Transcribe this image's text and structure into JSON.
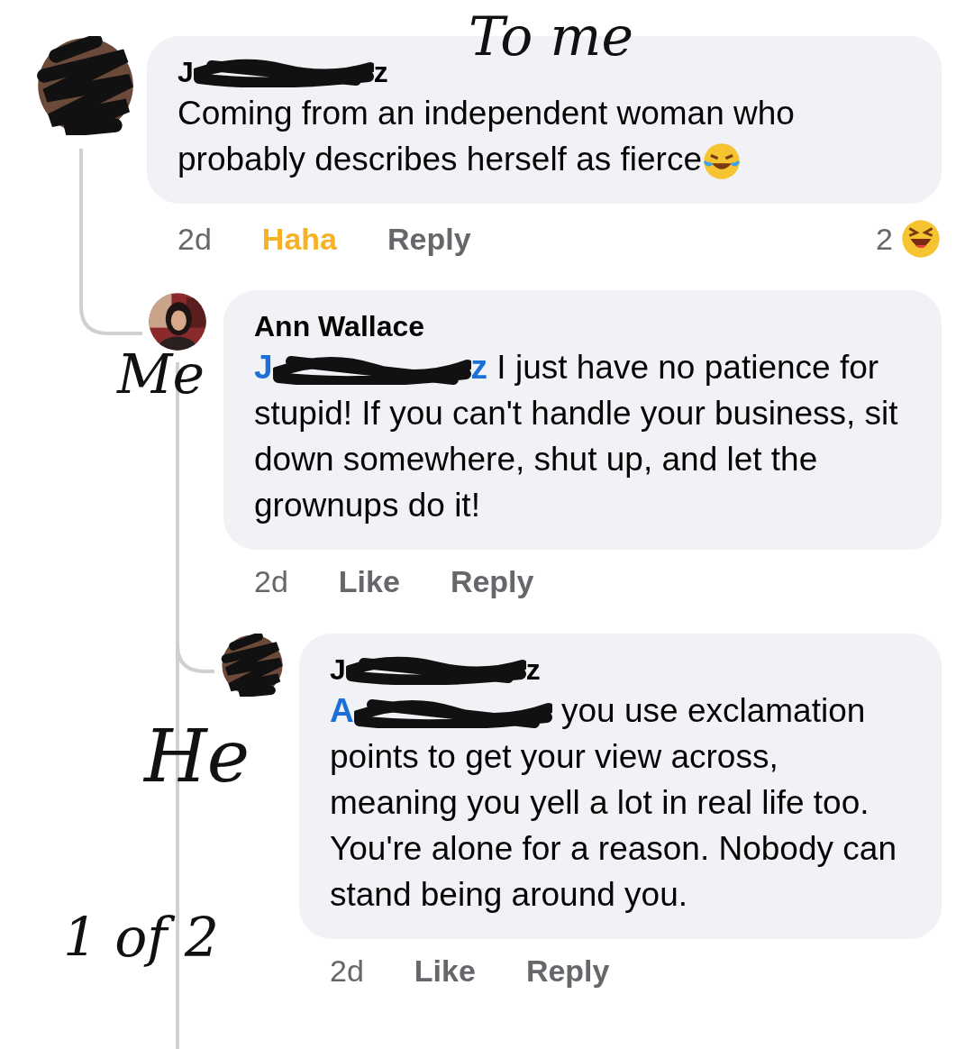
{
  "comments": [
    {
      "avatar": {
        "kind": "scribbled"
      },
      "name": {
        "start": "J",
        "end": "z",
        "redacted": true
      },
      "text": "Coming from an independent woman who probably describes herself as fierce",
      "emoji": true,
      "time": "2d",
      "reaction": "Haha",
      "reacted": true,
      "reply": "Reply",
      "reaction_count": "2",
      "children": [
        {
          "name": {
            "start": "Ann Wallace"
          },
          "mention": {
            "start": "J",
            "end": "z",
            "redacted": true
          },
          "text": "I just have no patience for stupid! If you can't handle your business, sit down somewhere, shut up, and let the grownups do it!",
          "time": "2d",
          "reaction": "Like",
          "reacted": false,
          "reply": "Reply",
          "children": [
            {
              "avatar": {
                "kind": "scribbled"
              },
              "name": {
                "start": "J",
                "end": "z",
                "redacted": true
              },
              "mention": {
                "start": "A",
                "redacted": true
              },
              "text": "you use exclamation points to get your view across, meaning you yell a lot in real life too. You're alone for a reason. Nobody can stand being around you.",
              "time": "2d",
              "reaction": "Like",
              "reacted": false,
              "reply": "Reply"
            }
          ]
        }
      ]
    }
  ],
  "annotations": [
    {
      "text": "To me"
    },
    {
      "text": "Me"
    },
    {
      "text": "He"
    },
    {
      "text": "1 of 2"
    }
  ]
}
